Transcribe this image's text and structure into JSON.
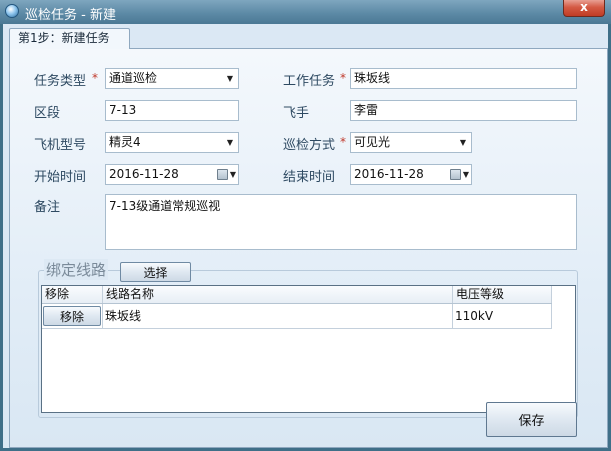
{
  "window": {
    "title": "巡检任务 - 新建",
    "close_label": "x"
  },
  "tab": {
    "label": "第1步：新建任务"
  },
  "form": {
    "task_type": {
      "label": "任务类型",
      "required": "*",
      "value": "通道巡检"
    },
    "work_task": {
      "label": "工作任务",
      "required": "*",
      "value": "珠坂线"
    },
    "section": {
      "label": "区段",
      "value": "7-13"
    },
    "pilot": {
      "label": "飞手",
      "value": "李雷"
    },
    "aircraft_model": {
      "label": "飞机型号",
      "value": "精灵4"
    },
    "patrol_mode": {
      "label": "巡检方式",
      "required": "*",
      "value": "可见光"
    },
    "start_time": {
      "label": "开始时间",
      "value": "2016-11-28"
    },
    "end_time": {
      "label": "结束时间",
      "value": "2016-11-28"
    },
    "remarks": {
      "label": "备注",
      "value": "7-13级通道常规巡视"
    }
  },
  "bind_lines": {
    "title": "绑定线路",
    "select_button": "选择",
    "columns": [
      "移除",
      "线路名称",
      "电压等级"
    ],
    "rows": [
      {
        "remove_button": "移除",
        "line_name": "珠坂线",
        "voltage": "110kV"
      }
    ]
  },
  "save_button": "保存"
}
